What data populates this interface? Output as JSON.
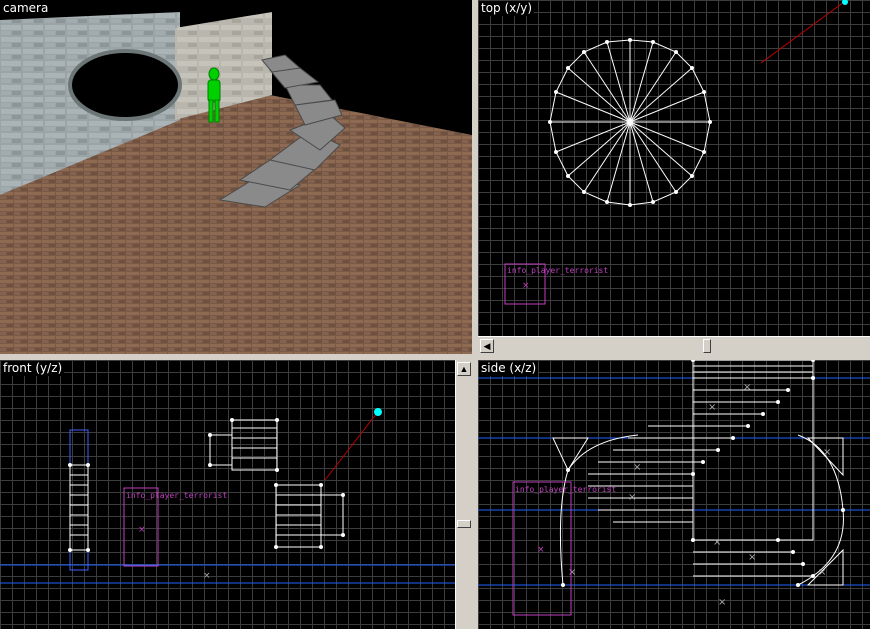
{
  "viewports": {
    "camera": {
      "label": "camera"
    },
    "top": {
      "label": "top (x/y)",
      "entity": "info_player_terrorist"
    },
    "front": {
      "label": "front (y/z)",
      "entity": "info_player_terrorist"
    },
    "side": {
      "label": "side (x/z)",
      "entity": "info_player_terrorist"
    }
  },
  "icons": {
    "scroll_left": "◀",
    "scroll_up": "▲"
  },
  "colors": {
    "grid": "#3c3c3c",
    "brush": "#ffffff",
    "entity": "#c040c0",
    "camera_ray": "#c00000",
    "camera_point": "#00ffff",
    "axis_line": "#2060ff"
  }
}
